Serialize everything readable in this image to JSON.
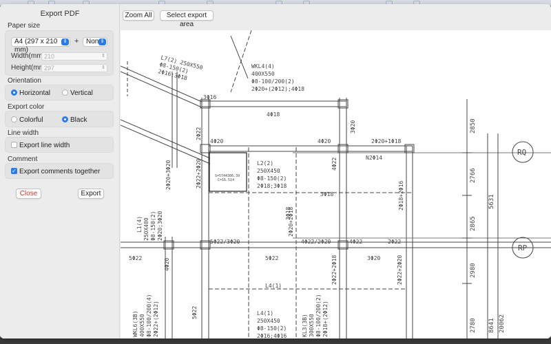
{
  "dialog": {
    "title": "Export PDF"
  },
  "paper_size": {
    "label": "Paper size",
    "size_value": "A4 (297 x 210 mm)",
    "plus": "+",
    "extra_value": "None",
    "width_label": "Width(mm)",
    "width_value": "210",
    "height_label": "Height(mm)",
    "height_value": "297"
  },
  "orientation": {
    "label": "Orientation",
    "options": [
      "Horizontal",
      "Vertical"
    ],
    "selected": "Horizontal"
  },
  "export_color": {
    "label": "Export color",
    "options": [
      "Colorful",
      "Black"
    ],
    "selected": "Black"
  },
  "line_width": {
    "label": "Line width",
    "checkbox_label": "Export line width",
    "checked": false
  },
  "comment": {
    "label": "Comment",
    "checkbox_label": "Export comments together",
    "checked": true
  },
  "buttons": {
    "close": "Close",
    "export": "Export",
    "zoom_all": "Zoom All",
    "select_area": "Select export area"
  },
  "drawing": {
    "beam_wkl": "WKL4(4)",
    "beam_size": "400X550",
    "beam_stirrup": "Φ8-100/200(2)",
    "beam_rebar": "2Φ20+(2Φ12);4Φ18",
    "beam_l7": "L7(2) 250X550",
    "beam_l7_b": "Φ8-150(2)",
    "beam_l7_c": "2Φ16;3Φ18",
    "beam_l2": "L2(2)",
    "beam_l2_size": "250X450",
    "beam_l2_b": "Φ8-150(2)",
    "beam_l2_c": "2Φ18;3Φ18",
    "beam_l4": "L4(1)",
    "beam_l4b": "L4(1)",
    "beam_l4b_size": "250X450",
    "beam_l4b_b": "Φ8-150(2)",
    "beam_l4b_c": "2Φ16;4Φ16",
    "beam_l1": "L1(4)",
    "beam_l1_size": "250X400",
    "beam_l1_b": "Φ8-150(2)",
    "beam_l1_c": "2Φ20;3Φ20",
    "beam_wkl6": "WKL6(3B)",
    "beam_wkl6_size": "400X550",
    "beam_wkl6_b": "Φ8-100/200(4)",
    "beam_wkl6_c": "2Φ22+(2Φ12)",
    "beam_kl3": "KL3(3B)",
    "beam_kl3_size": "300X550",
    "beam_kl3_b": "Φ8-100/200(2)",
    "beam_kl3_c": "2Φ18+(2Φ12)",
    "n2": "N2Φ14",
    "comment_a": "S=5744306.39",
    "comment_b": "C=16.514",
    "r_4f18": "4Φ18",
    "r_4f20": "4Φ20",
    "r_4f20b": "4Φ20",
    "r_3f16": "3Φ16",
    "r_3f18": "3Φ18",
    "r_3f18b": "3Φ18",
    "r_3f20": "3Φ20",
    "r_5f22": "5Φ22",
    "r_5f22b": "5Φ22",
    "r_4f22": "4Φ22",
    "r_2f22": "2Φ22",
    "r_2f20": "2Φ20+1Φ18",
    "r_5f22c": "5Φ22/3Φ20",
    "r_4f22c": "4Φ22/2Φ20",
    "r_4f22d": "4Φ22",
    "r_2f22c": "2Φ22",
    "r_5f22d": "5Φ22",
    "r_3f20b": "3Φ20",
    "r_4f20c": "4Φ20",
    "r_v1": "2Φ22+2Φ20",
    "r_v2": "2Φ20+3Φ20",
    "r_v3": "2Φ18+2Φ16",
    "r_v4": "2Φ22+2Φ18",
    "r_v5": "2Φ20+2Φ18",
    "r_v6": "2Φ22+2Φ20",
    "axis_rq": "RQ",
    "axis_rp": "RP",
    "dim_2850": "2850",
    "dim_2766": "2766",
    "dim_2865": "2865",
    "dim_2980": "2980",
    "dim_2780": "2780",
    "dim_5631": "5631",
    "dim_8641": "8641",
    "dim_20062": "20062"
  }
}
